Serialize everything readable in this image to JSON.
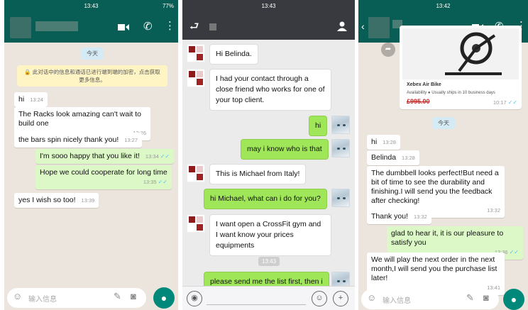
{
  "screen1": {
    "status_time": "13:43",
    "status_right": "77%",
    "date_pill": "今天",
    "encryption_note": "🔒 此对话中的信息和通话已进行端到端的加密，点击获取更多信息。",
    "messages": [
      {
        "text": "hi",
        "time": "13:24"
      },
      {
        "text": "The Racks look amazing can't wait to build one",
        "time": "13:26"
      },
      {
        "text": "the bars spin nicely thank you!",
        "time": "13:27"
      },
      {
        "text": "I'm sooo happy that you like it!",
        "time": "13:34"
      },
      {
        "text": "Hope we could cooperate for long time",
        "time": "13:35"
      },
      {
        "text": "yes I wish so too!",
        "time": "13:39"
      }
    ],
    "input_placeholder": "输入信息"
  },
  "screen2": {
    "status_time": "13:43",
    "timestamp": "13:43",
    "messages": [
      {
        "text": "Hi Belinda."
      },
      {
        "text": "I had your contact through a close friend who works for one of your top client."
      },
      {
        "text": "hi"
      },
      {
        "text": "may i know who is that"
      },
      {
        "text": "This is Michael from Italy!"
      },
      {
        "text": "hi Michael, what can i do for you?"
      },
      {
        "text": "I want open a CrossFit gym and I want know your prices equipments"
      },
      {
        "text": "please send me the list first, then i"
      }
    ]
  },
  "screen3": {
    "status_time": "13:42",
    "contact_suffix": "上",
    "product": {
      "name": "Xebex Air Bike",
      "availability": "Availability   ● Usually ships in 10 business days",
      "price": "£995.00",
      "time": "10:17"
    },
    "date_pill": "今天",
    "messages": [
      {
        "text": "hi",
        "time": "13:28"
      },
      {
        "text": "Belinda",
        "time": "13:28"
      },
      {
        "text": "The dumbbell looks perfect!But need a bit of time to see the durability and finishing.I will send you the feedback after checking!",
        "time": "13:32"
      },
      {
        "text": "Thank you!",
        "time": "13:32"
      },
      {
        "text": "glad to hear it, it is our pleasure to satisfy you",
        "time": "13:36"
      },
      {
        "text": "We will play the next order in the next month,I will send you the purchase list later!",
        "time": "13:41"
      }
    ],
    "input_placeholder": "输入信息"
  },
  "colors": {
    "whatsapp_header": "#085e54",
    "whatsapp_bg": "#ece5dd",
    "whatsapp_out_bubble": "#dcf8c6",
    "wechat_header": "#393a3f",
    "wechat_out_bubble": "#9fe658"
  },
  "icons": [
    "video-call-icon",
    "phone-icon",
    "more-vert-icon",
    "back-arrow-icon",
    "person-icon",
    "emoji-icon",
    "attach-icon",
    "camera-icon",
    "mic-icon",
    "voice-icon",
    "plus-icon"
  ]
}
